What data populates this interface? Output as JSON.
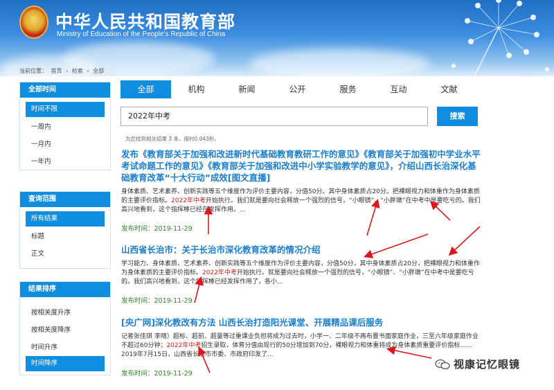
{
  "header": {
    "title": "中华人民共和国教育部",
    "subtitle": "Ministry of Education of the People's Republic of China"
  },
  "breadcrumb": [
    "当前位置：",
    "首页",
    "›",
    "检索",
    "›",
    "全部"
  ],
  "sidebar": {
    "time": {
      "heading": "全部时间",
      "items": [
        "时间不限",
        "一周内",
        "一月内",
        "一年内"
      ],
      "active_index": 0
    },
    "scope": {
      "heading": "查询范围",
      "items": [
        "所有结果",
        "标题",
        "正文"
      ],
      "active_index": 0
    },
    "sort": {
      "heading": "结果排序",
      "items": [
        "按相关度升序",
        "按相关度降序",
        "时间升序",
        "时间降序"
      ],
      "active_index": 3
    }
  },
  "tabs": [
    "全部",
    "机构",
    "新闻",
    "公开",
    "服务",
    "互动",
    "文献"
  ],
  "active_tab": 0,
  "search": {
    "value": "2022年中考",
    "button": "搜索"
  },
  "result_info": {
    "prefix": "为您找到相关结果",
    "count": "3",
    "middle": "条，用时0.043秒。"
  },
  "results": [
    {
      "title": "发布《教育部关于加强和改进新时代基础教育教研工作的意见》《教育部关于加强初中学业水平考试命题工作的意见》《教育部关于加强和改进中小学实验教学的意见》，介绍山西长治深化基础教育改革“十大行动”成效[图文直播]",
      "snippet_1": "身体素质、艺术素养、创新实践等五个维度作为评价主要内容，分值50分。其中身体素质占20分。把裸眼视力和体重作为身体素质的主要评价指标。",
      "highlight": "2022年中考",
      "snippet_2": "开始执行。我们就是要向社会释放一个强烈的信号，“小眼镜”、“小胖墩”在中考中是要吃亏的。我们高兴地看到，这个指挥棒已经在发挥作用。...",
      "date": "发布时间：2019-11-29"
    },
    {
      "title": "山西省长治市：关于长治市深化教育改革的情况介绍",
      "snippet_1": "学习能力、身体素质、艺术素养、创新实践等五个维度作为评价主要内容，分值50分，其中身体素质占20分，把裸眼视力和体重作为身体素质的主要评价指标。",
      "highlight": "2022年中考",
      "snippet_2": "开始执行。就是要向社会释放一个强烈的信号，“小眼镜”、“小胖墩”在中考中是要吃亏的。我们高兴地看到，这个指挥棒已经发挥作用了，各小...",
      "date": "发布时间：2019-11-29"
    },
    {
      "title": "[央广网]深化教改有方法 山西长治打造阳光课堂、开展精品课后服务",
      "snippet_1": "记者张佳琪 李晴）超标、超前、超量等过重课业负担将成为过去时，小学一、二年级不再布置书面家庭作业，三至六年级家庭作业不超过60分钟；",
      "highlight": "2022年中考",
      "snippet_2": "招生录取，体育分值由现行的50分增加到70分，裸眼视力和体重将成为身体素质重要评价指标……2019年7月15日，山西省长治市市委、市政府印发了...",
      "date": "发布时间：2019-11-29"
    }
  ],
  "watermark": "视康记忆眼镜",
  "colors": {
    "accent": "#0f8edf",
    "link": "#1a7fcf",
    "highlight": "#d0211c",
    "date": "#2a8a1f",
    "annotation": "#e0161c"
  }
}
